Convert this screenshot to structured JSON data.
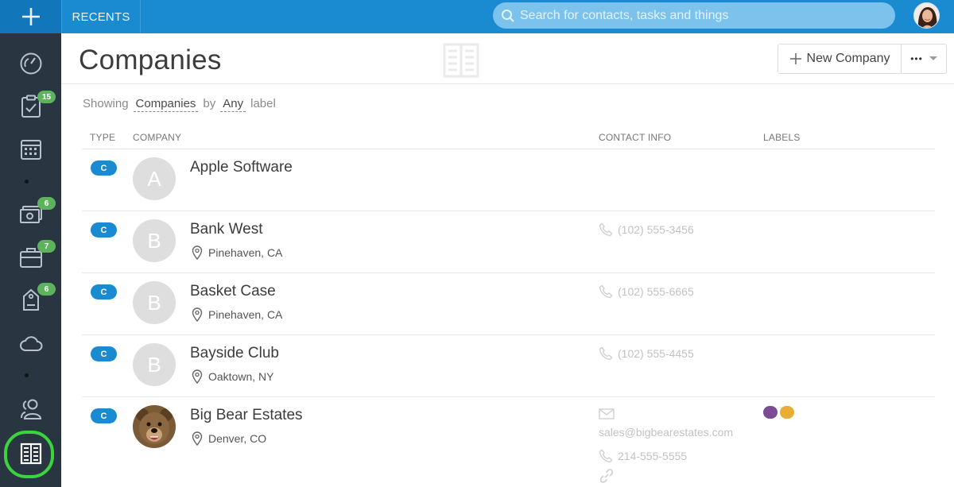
{
  "topbar": {
    "recents_label": "RECENTS",
    "search_placeholder": "Search for contacts, tasks and things"
  },
  "sidebar": {
    "items": [
      {
        "name": "dashboard",
        "icon": "gauge-icon",
        "badge": ""
      },
      {
        "name": "tasks",
        "icon": "clipboard-check-icon",
        "badge": "15"
      },
      {
        "name": "calendar",
        "icon": "calendar-icon",
        "badge": ""
      },
      {
        "name": "opportunities",
        "icon": "money-icon",
        "badge": "6"
      },
      {
        "name": "projects",
        "icon": "briefcase-icon",
        "badge": "7"
      },
      {
        "name": "cases",
        "icon": "tag-icon",
        "badge": "6"
      },
      {
        "name": "cloud",
        "icon": "cloud-icon",
        "badge": ""
      },
      {
        "name": "people",
        "icon": "people-icon",
        "badge": ""
      },
      {
        "name": "companies",
        "icon": "building-icon",
        "badge": ""
      }
    ]
  },
  "page": {
    "title": "Companies",
    "new_button_label": "New Company",
    "more_button_label": "•••"
  },
  "filter": {
    "showing": "Showing",
    "entity": "Companies",
    "by": "by",
    "label_value": "Any",
    "label_word": "label"
  },
  "table": {
    "headers": {
      "type": "TYPE",
      "company": "COMPANY",
      "contact": "CONTACT INFO",
      "labels": "LABELS"
    },
    "rows": [
      {
        "type": "C",
        "initial": "A",
        "name": "Apple Software",
        "location": "",
        "phone": "",
        "email": ""
      },
      {
        "type": "C",
        "initial": "B",
        "name": "Bank West",
        "location": "Pinehaven, CA",
        "phone": "(102) 555-3456",
        "email": ""
      },
      {
        "type": "C",
        "initial": "B",
        "name": "Basket Case",
        "location": "Pinehaven, CA",
        "phone": "(102) 555-6665",
        "email": ""
      },
      {
        "type": "C",
        "initial": "B",
        "name": "Bayside Club",
        "location": "Oaktown, NY",
        "phone": "(102) 555-4455",
        "email": ""
      },
      {
        "type": "C",
        "initial": "",
        "name": "Big Bear Estates",
        "location": "Denver, CO",
        "phone": "214-555-5555",
        "email": "sales@bigbearestates.com"
      }
    ]
  },
  "colors": {
    "brand_blue": "#1a8ad1",
    "sidebar_bg": "#2a3542",
    "badge_green": "#5db35b",
    "active_ring": "#3cd43e",
    "label_purple": "#7b4b95",
    "label_yellow": "#e8ae34"
  }
}
